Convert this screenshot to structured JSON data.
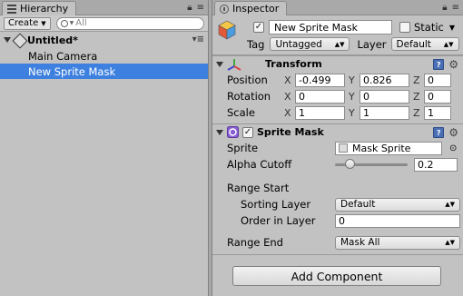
{
  "hierarchy": {
    "tab_title": "Hierarchy",
    "create_label": "Create",
    "search_placeholder": "All",
    "scene_name": "Untitled*",
    "items": [
      {
        "label": "Main Camera",
        "selected": false
      },
      {
        "label": "New Sprite Mask",
        "selected": true
      }
    ]
  },
  "inspector": {
    "tab_title": "Inspector",
    "object_name": "New Sprite Mask",
    "active": true,
    "static_label": "Static",
    "static_checked": false,
    "tag_label": "Tag",
    "tag_value": "Untagged",
    "layer_label": "Layer",
    "layer_value": "Default",
    "transform": {
      "title": "Transform",
      "rows": [
        {
          "label": "Position",
          "x": "-0.499",
          "y": "0.826",
          "z": "0"
        },
        {
          "label": "Rotation",
          "x": "0",
          "y": "0",
          "z": "0"
        },
        {
          "label": "Scale",
          "x": "1",
          "y": "1",
          "z": "1"
        }
      ]
    },
    "sprite_mask": {
      "title": "Sprite Mask",
      "enabled": true,
      "sprite_label": "Sprite",
      "sprite_value": "Mask Sprite",
      "alpha_label": "Alpha Cutoff",
      "alpha_value": "0.2",
      "alpha_fraction": 0.2,
      "range_start_label": "Range Start",
      "sorting_layer_label": "Sorting Layer",
      "sorting_layer_value": "Default",
      "order_label": "Order in Layer",
      "order_value": "0",
      "range_end_label": "Range End",
      "range_end_value": "Mask All"
    },
    "add_component_label": "Add Component"
  },
  "colors": {
    "selection": "#3d80df",
    "panel": "#c2c2c2",
    "transform_icon_red": "#d44",
    "transform_icon_green": "#4a4",
    "transform_icon_blue": "#44c",
    "sprite_mask_icon": "#8a5cd6"
  }
}
